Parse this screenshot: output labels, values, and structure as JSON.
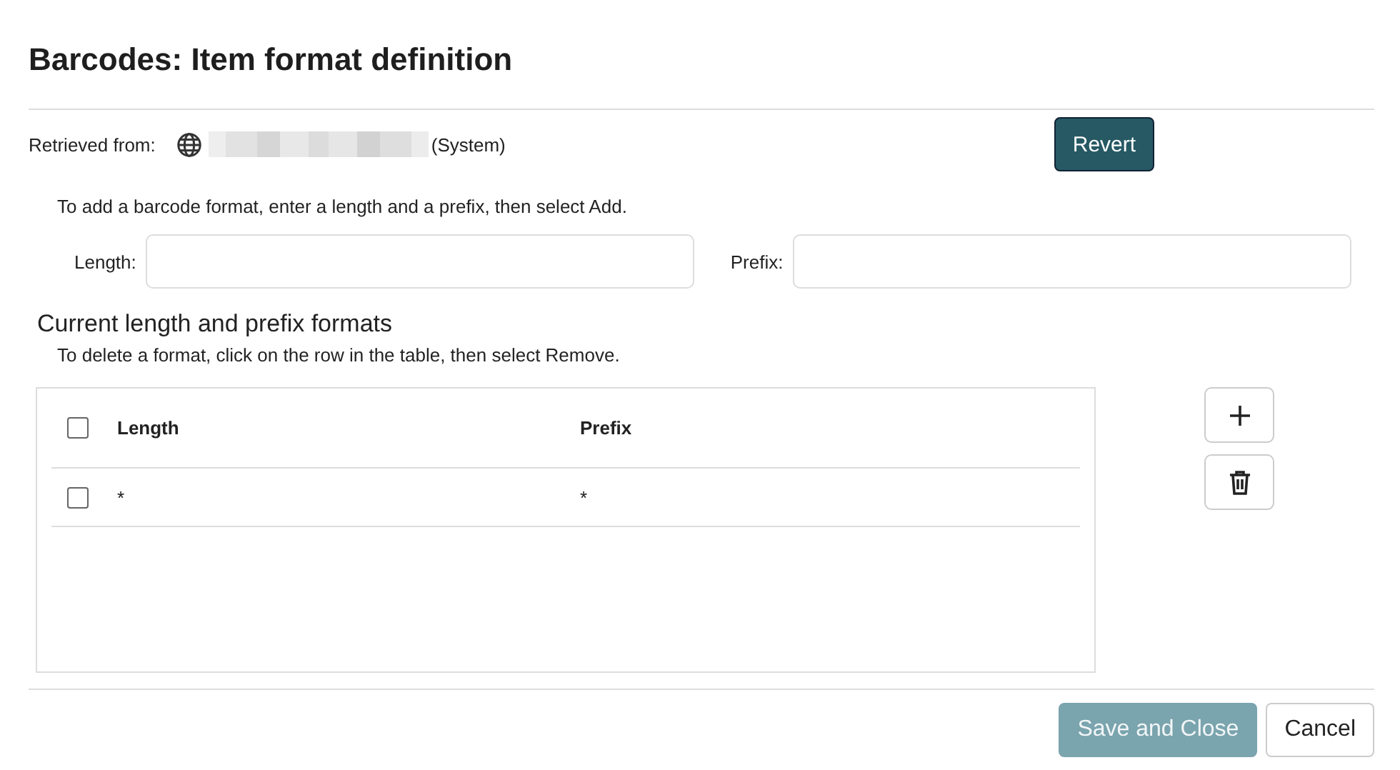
{
  "title": "Barcodes: Item format definition",
  "retrieved": {
    "label": "Retrieved from:",
    "source_suffix": "(System)"
  },
  "revert_button": {
    "label": "Revert",
    "disabled": false
  },
  "add_instruction": "To add a barcode format, enter a length and a prefix, then select Add.",
  "fields": [
    {
      "label": "Length:"
    },
    {
      "label": "Prefix:"
    }
  ],
  "formats": {
    "heading": "Current length and prefix formats",
    "instruction": "To delete a format, click on the row in the table, then select Remove.",
    "columns": [
      "Length",
      "Prefix"
    ],
    "header_checked": false,
    "rows": [
      {
        "checked": false,
        "cells": [
          "*",
          "*"
        ]
      }
    ]
  },
  "footer_buttons": [
    {
      "label": "Save and Close",
      "kind": "primary",
      "disabled": true
    },
    {
      "label": "Cancel",
      "kind": "secondary",
      "disabled": false
    }
  ]
}
